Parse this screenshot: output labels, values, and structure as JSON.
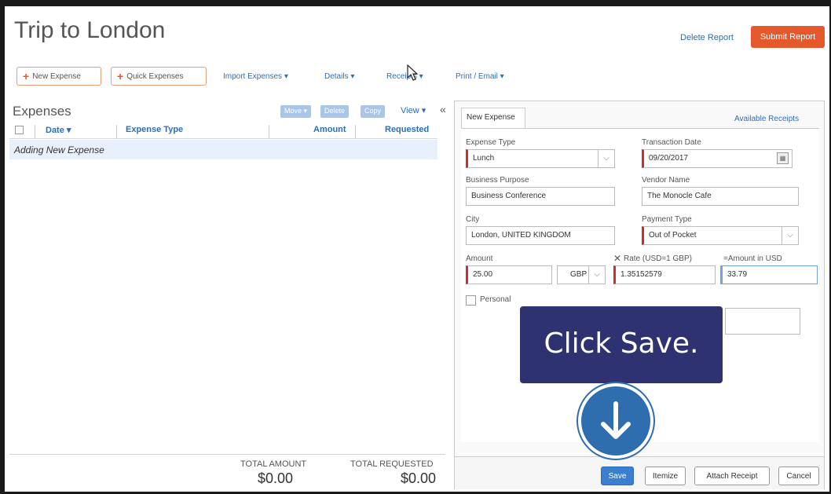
{
  "header": {
    "title": "Trip to London",
    "delete_report": "Delete Report",
    "submit_report": "Submit Report"
  },
  "toolbar": {
    "new_expense": "New Expense",
    "quick_expenses": "Quick Expenses",
    "import_expenses": "Import Expenses ▾",
    "details": "Details ▾",
    "receipts": "Receipts ▾",
    "print_email": "Print / Email ▾"
  },
  "expenses": {
    "title": "Expenses",
    "move": "Move ▾",
    "delete": "Delete",
    "copy": "Copy",
    "view": "View ▾",
    "collapse": "«",
    "columns": {
      "date": "Date ▾",
      "type": "Expense Type",
      "amount": "Amount",
      "requested": "Requested"
    },
    "new_row": "Adding New Expense",
    "total_amount_label": "TOTAL AMOUNT",
    "total_amount": "$0.00",
    "total_requested_label": "TOTAL REQUESTED",
    "total_requested": "$0.00"
  },
  "form": {
    "tab": "New Expense",
    "available_receipts": "Available Receipts",
    "expense_type_label": "Expense Type",
    "expense_type": "Lunch",
    "transaction_date_label": "Transaction Date",
    "transaction_date": "09/20/2017",
    "business_purpose_label": "Business Purpose",
    "business_purpose": "Business Conference",
    "vendor_name_label": "Vendor Name",
    "vendor_name": "The Monocle Cafe",
    "city_label": "City",
    "city": "London, UNITED KINGDOM",
    "payment_type_label": "Payment Type",
    "payment_type": "Out of Pocket",
    "amount_label": "Amount",
    "amount": "25.00",
    "currency": "GBP",
    "rate_label": "Rate (USD=1 GBP)",
    "rate": "1.35152579",
    "amount_usd_label": "=Amount in USD",
    "amount_usd": "33.79",
    "personal_label": "Personal"
  },
  "buttons": {
    "save": "Save",
    "itemize": "Itemize",
    "attach_receipt": "Attach Receipt",
    "cancel": "Cancel"
  },
  "overlay": {
    "callout": "Click Save."
  },
  "icons": {
    "plus": "plus-icon",
    "calendar": "calendar-icon",
    "arrow_down": "arrow-down-circle-icon",
    "cursor": "mouse-cursor-icon"
  }
}
